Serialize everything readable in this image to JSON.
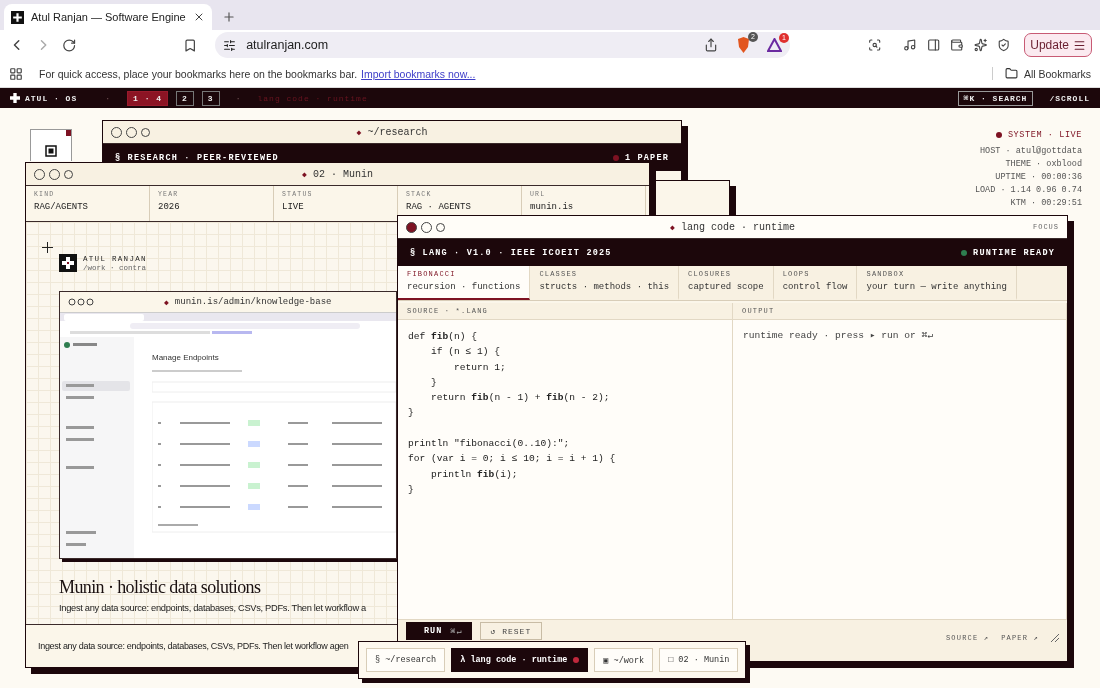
{
  "browser": {
    "tab_title": "Atul Ranjan — Software Engine",
    "address": "atulranjan.com",
    "shield_count": "2",
    "alert_count": "1",
    "update": "Update",
    "bookmarks_hint": "For quick access, place your bookmarks here on the bookmarks bar.",
    "import_link": "Import bookmarks now...",
    "all_bookmarks": "All Bookmarks"
  },
  "topbar": {
    "brand": "ATUL · OS",
    "separator": "·",
    "pages": [
      {
        "label": "1 · 4",
        "selected": true
      },
      {
        "label": "2",
        "selected": false
      },
      {
        "label": "3",
        "selected": false
      }
    ],
    "current": "lang code · runtime",
    "search": "⌘K · SEARCH",
    "scroll": "/SCROLL"
  },
  "system": {
    "status": "SYSTEM · LIVE",
    "rows": [
      "HOST · atul@gottdata",
      "THEME · oxblood",
      "UPTIME · 00:00:36",
      "LOAD · 1.14 0.96 0.74",
      "KTM · 00:29:51"
    ]
  },
  "research": {
    "marker": "◆",
    "title": "~/research",
    "active": false,
    "banner": "§ RESEARCH · PEER-REVIEWED",
    "count": "1 PAPER"
  },
  "munin": {
    "marker": "◆",
    "title": "02 · Munin",
    "active": false,
    "meta": [
      {
        "label": "KIND",
        "value": "RAG/AGENTS"
      },
      {
        "label": "YEAR",
        "value": "2026"
      },
      {
        "label": "STATUS",
        "value": "LIVE"
      },
      {
        "label": "STACK",
        "value": "RAG · AGENTS"
      },
      {
        "label": "URL",
        "value": "munin.is"
      }
    ],
    "author": "ATUL RANJAN",
    "author_path": "/work · contra",
    "preview": {
      "marker": "◆",
      "url": "munin.is/admin/knowledge-base",
      "page_title": "Manage Endpoints"
    },
    "heading": "Munin · holistic data solutions",
    "description": "Ingest any data source: endpoints, databases, CSVs, PDFs. Then let workflow a",
    "footer": "Ingest any data source: endpoints, databases, CSVs, PDFs. Then let workflow agen"
  },
  "lang": {
    "marker": "◆",
    "title": "lang code · runtime",
    "active": true,
    "focus": "FOCUS",
    "banner": "§ LANG · V1.0 · IEEE ICOEIT 2025",
    "status": "RUNTIME READY",
    "tabs": [
      {
        "title": "FIBONACCI",
        "subtitle": "recursion · functions",
        "selected": true
      },
      {
        "title": "CLASSES",
        "subtitle": "structs · methods · this",
        "selected": false
      },
      {
        "title": "CLOSURES",
        "subtitle": "captured scope",
        "selected": false
      },
      {
        "title": "LOOPS",
        "subtitle": "control flow",
        "selected": false
      },
      {
        "title": "SANDBOX",
        "subtitle": "your turn — write anything",
        "selected": false
      }
    ],
    "source_label": "SOURCE · *.LANG",
    "output_label": "OUTPUT",
    "code": [
      {
        "text": "def **fib**(n) {"
      },
      {
        "text": "    if (n ≤ 1) {"
      },
      {
        "text": "        return 1;"
      },
      {
        "text": "    }"
      },
      {
        "text": "    return **fib**(n - 1) + **fib**(n - 2);"
      },
      {
        "text": "}"
      },
      {
        "text": "println \"fibonacci(0..10):\";",
        "blank_before": true
      },
      {
        "text": "for (var i = 0; i ≤ 10; i = i + 1) {"
      },
      {
        "text": "    println **fib**(i);"
      },
      {
        "text": "}"
      }
    ],
    "output": "runtime ready · press ▸ run or ⌘↵",
    "run": "RUN",
    "run_shortcut": "⌘↵",
    "reset": "↺ RESET",
    "links": [
      "SOURCE ↗",
      "PAPER ↗"
    ]
  },
  "dock": [
    {
      "label": "§ ~/research",
      "selected": false
    },
    {
      "label": "λ lang code · runtime",
      "selected": true
    },
    {
      "label": "▣ ~/work",
      "selected": false
    },
    {
      "label": "□ 02 · Munin",
      "selected": false
    }
  ]
}
